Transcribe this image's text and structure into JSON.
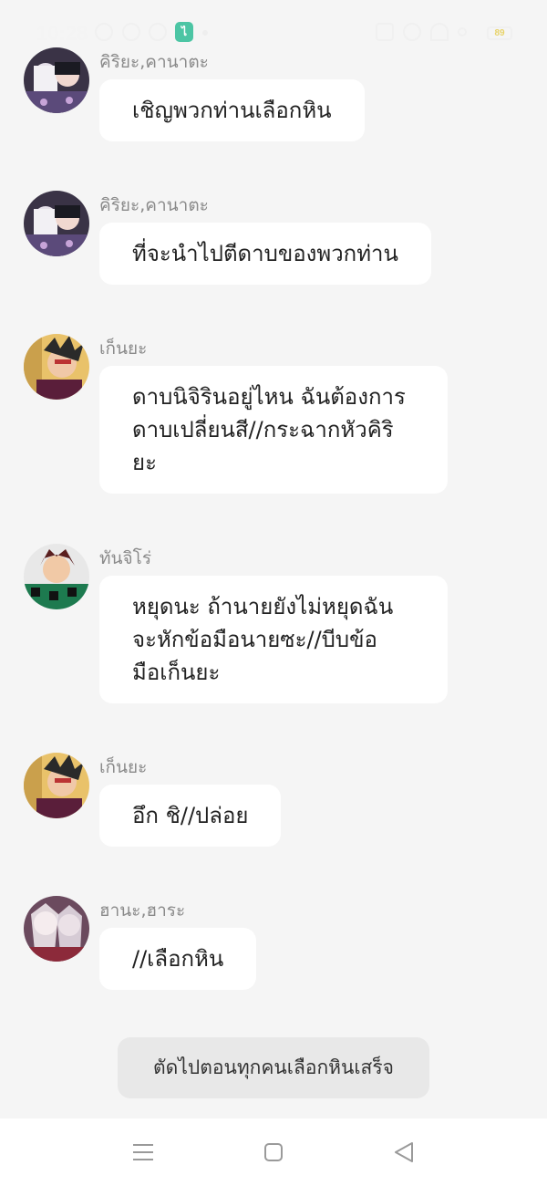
{
  "status_bar": {
    "time": "10:28",
    "battery": "89",
    "app_icon_glyph": "ไ",
    "icons": [
      "chat-bubble-icon",
      "facebook-icon",
      "sync-icon",
      "app-icon",
      "vibrate-icon",
      "alarm-icon",
      "wifi-icon",
      "signal-icon",
      "battery-icon"
    ]
  },
  "messages": [
    {
      "sender": "คิริยะ,คานาตะ",
      "text": "เชิญพวกท่านเลือกหิน",
      "avatar": "kiriya-kanata-avatar"
    },
    {
      "sender": "คิริยะ,คานาตะ",
      "text": "ที่จะนำไปตีดาบของพวกท่าน",
      "avatar": "kiriya-kanata-avatar"
    },
    {
      "sender": "เก็นยะ",
      "lines": [
        "ดาบนิจิรินอยู่ไหน ฉันต้องการ",
        "ดาบเปลี่ยนสี//กระฉากหัวคิริ",
        "ยะ"
      ],
      "avatar": "genya-avatar"
    },
    {
      "sender": "ทันจิโร่",
      "lines": [
        "หยุดนะ ถ้านายยังไม่หยุดฉัน",
        "จะหักข้อมือนายซะ//บีบข้อ",
        "มือเก็นยะ"
      ],
      "avatar": "tanjiro-avatar"
    },
    {
      "sender": "เก็นยะ",
      "text": "อึก ชิ//ปล่อย",
      "avatar": "genya-avatar"
    },
    {
      "sender": "ฮานะ,ฮาระ",
      "text": "//เลือกหิน",
      "avatar": "hana-hara-avatar"
    }
  ],
  "narration": "ตัดไปตอนทุกคนเลือกหินเสร็จ",
  "nav_bar": {
    "buttons": [
      "menu-icon",
      "home-square-icon",
      "back-triangle-icon"
    ]
  },
  "colors": {
    "background": "#f5f5f5",
    "bubble": "#ffffff",
    "narration_bg": "#e8e8e8",
    "sender_text": "#8a8a8a"
  }
}
